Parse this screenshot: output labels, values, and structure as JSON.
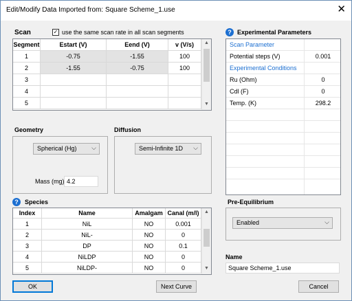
{
  "window": {
    "title": "Edit/Modify Data Imported from:  Square Scheme_1.use",
    "close_glyph": "✕"
  },
  "scan": {
    "label": "Scan",
    "same_rate_label": "use the same scan rate in all scan segments",
    "same_rate_checked": true,
    "columns": [
      "Segment",
      "Estart (V)",
      "Eend (V)",
      "v (V/s)"
    ],
    "rows": [
      [
        "1",
        "-0.75",
        "-1.55",
        "100"
      ],
      [
        "2",
        "-1.55",
        "-0.75",
        "100"
      ],
      [
        "3",
        "",
        "",
        ""
      ],
      [
        "4",
        "",
        "",
        ""
      ],
      [
        "5",
        "",
        "",
        ""
      ]
    ]
  },
  "geometry": {
    "label": "Geometry",
    "selected": "Spherical (Hg)",
    "mass_label": "Mass (mg)",
    "mass_value": "4.2"
  },
  "diffusion": {
    "label": "Diffusion",
    "selected": "Semi-Infinite 1D"
  },
  "species": {
    "label": "Species",
    "columns": [
      "Index",
      "Name",
      "Amalgam",
      "Canal (m/l)"
    ],
    "rows": [
      [
        "1",
        "NiL",
        "NO",
        "0.001"
      ],
      [
        "2",
        "NiL-",
        "NO",
        "0"
      ],
      [
        "3",
        "DP",
        "NO",
        "0.1"
      ],
      [
        "4",
        "NiLDP",
        "NO",
        "0"
      ],
      [
        "5",
        "NiLDP-",
        "NO",
        "0"
      ]
    ]
  },
  "experimental": {
    "label": "Experimental Parameters",
    "scan_param_label": "Scan Parameter",
    "potential_steps_label": "Potential steps (V)",
    "potential_steps_value": "0.001",
    "conditions_label": "Experimental Conditions",
    "ru_label": "Ru (Ohm)",
    "ru_value": "0",
    "cdl_label": "Cdl (F)",
    "cdl_value": "0",
    "temp_label": "Temp. (K)",
    "temp_value": "298.2"
  },
  "pre_equilibrium": {
    "label": "Pre-Equilibrium",
    "selected": "Enabled"
  },
  "name": {
    "label": "Name",
    "value": "Square Scheme_1.use"
  },
  "buttons": {
    "ok": "OK",
    "next_curve": "Next Curve",
    "cancel": "Cancel"
  },
  "icons": {
    "help": "?",
    "chevron": "⌵",
    "up": "▲",
    "down": "▼",
    "check": "✓"
  }
}
